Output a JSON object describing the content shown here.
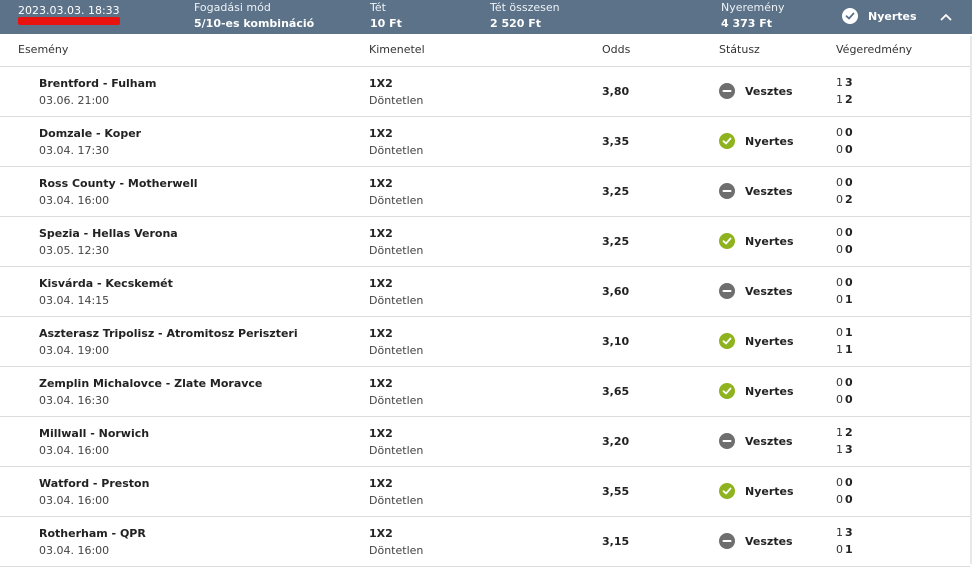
{
  "header": {
    "date": "2023.03.03. 18:33",
    "mode_label": "Fogadási mód",
    "mode_value": "5/10-es kombináció",
    "stake_label": "Tét",
    "stake_value": "10 Ft",
    "total_label": "Tét összesen",
    "total_value": "2 520 Ft",
    "win_label": "Nyeremény",
    "win_value": "4 373 Ft",
    "status": "Nyertes"
  },
  "columns": {
    "event": "Esemény",
    "outcome": "Kimenetel",
    "odds": "Odds",
    "status": "Státusz",
    "result": "Végeredmény"
  },
  "colors": {
    "header_bg": "#5b7289",
    "won": "#8fb31e",
    "lost": "#6e6e6e",
    "redaction": "#e8130f"
  },
  "rows": [
    {
      "event": "Brentford - Fulham",
      "date": "03.06. 21:00",
      "market": "1X2",
      "outcome": "Döntetlen",
      "odds": "3,80",
      "status": "Vesztes",
      "won": false,
      "s1a": "1",
      "s1b": "3",
      "s2a": "1",
      "s2b": "2"
    },
    {
      "event": "Domzale - Koper",
      "date": "03.04. 17:30",
      "market": "1X2",
      "outcome": "Döntetlen",
      "odds": "3,35",
      "status": "Nyertes",
      "won": true,
      "s1a": "0",
      "s1b": "0",
      "s2a": "0",
      "s2b": "0"
    },
    {
      "event": "Ross County - Motherwell",
      "date": "03.04. 16:00",
      "market": "1X2",
      "outcome": "Döntetlen",
      "odds": "3,25",
      "status": "Vesztes",
      "won": false,
      "s1a": "0",
      "s1b": "0",
      "s2a": "0",
      "s2b": "2"
    },
    {
      "event": "Spezia - Hellas Verona",
      "date": "03.05. 12:30",
      "market": "1X2",
      "outcome": "Döntetlen",
      "odds": "3,25",
      "status": "Nyertes",
      "won": true,
      "s1a": "0",
      "s1b": "0",
      "s2a": "0",
      "s2b": "0"
    },
    {
      "event": "Kisvárda - Kecskemét",
      "date": "03.04. 14:15",
      "market": "1X2",
      "outcome": "Döntetlen",
      "odds": "3,60",
      "status": "Vesztes",
      "won": false,
      "s1a": "0",
      "s1b": "0",
      "s2a": "0",
      "s2b": "1"
    },
    {
      "event": "Aszterasz Tripolisz - Atromitosz Periszteri",
      "date": "03.04. 19:00",
      "market": "1X2",
      "outcome": "Döntetlen",
      "odds": "3,10",
      "status": "Nyertes",
      "won": true,
      "s1a": "0",
      "s1b": "1",
      "s2a": "1",
      "s2b": "1"
    },
    {
      "event": "Zemplin Michalovce - Zlate Moravce",
      "date": "03.04. 16:30",
      "market": "1X2",
      "outcome": "Döntetlen",
      "odds": "3,65",
      "status": "Nyertes",
      "won": true,
      "s1a": "0",
      "s1b": "0",
      "s2a": "0",
      "s2b": "0"
    },
    {
      "event": "Millwall - Norwich",
      "date": "03.04. 16:00",
      "market": "1X2",
      "outcome": "Döntetlen",
      "odds": "3,20",
      "status": "Vesztes",
      "won": false,
      "s1a": "1",
      "s1b": "2",
      "s2a": "1",
      "s2b": "3"
    },
    {
      "event": "Watford - Preston",
      "date": "03.04. 16:00",
      "market": "1X2",
      "outcome": "Döntetlen",
      "odds": "3,55",
      "status": "Nyertes",
      "won": true,
      "s1a": "0",
      "s1b": "0",
      "s2a": "0",
      "s2b": "0"
    },
    {
      "event": "Rotherham - QPR",
      "date": "03.04. 16:00",
      "market": "1X2",
      "outcome": "Döntetlen",
      "odds": "3,15",
      "status": "Vesztes",
      "won": false,
      "s1a": "1",
      "s1b": "3",
      "s2a": "0",
      "s2b": "1"
    }
  ]
}
